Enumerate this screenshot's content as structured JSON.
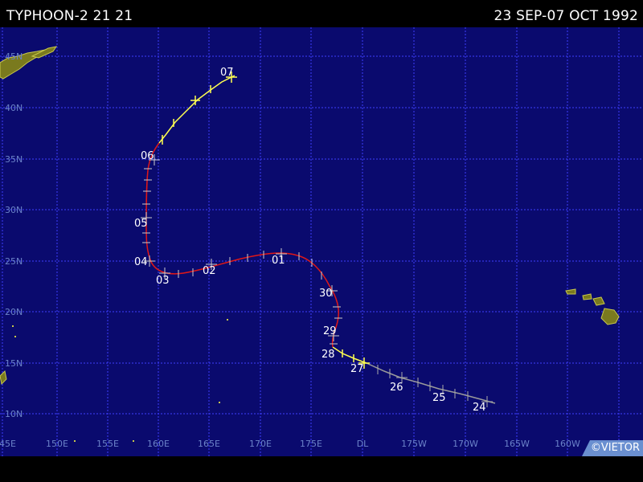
{
  "header": {
    "storm_name": "TYPHOON-2 21 21",
    "date_range": "23 SEP-07 OCT 1992"
  },
  "credit": "©VIETOR",
  "map": {
    "colors": {
      "ocean": "#0a0a6e",
      "grid": "#3d3dff",
      "land": "#7a7a1e",
      "land_edge": "#c8c84a",
      "axis_label": "#6b83c9",
      "track_depression": "#9a9a9a",
      "track_storm": "#ffff50",
      "track_typhoon": "#e01818",
      "day_label": "#ffffff"
    },
    "longitude_labels": [
      "145E",
      "150E",
      "155E",
      "160E",
      "165E",
      "170E",
      "175E",
      "DL",
      "175W",
      "170W",
      "165W",
      "160W"
    ],
    "latitude_labels": [
      "10N",
      "15N",
      "20N",
      "25N",
      "30N",
      "35N",
      "40N",
      "45N"
    ],
    "day_labels": [
      "24",
      "25",
      "26",
      "27",
      "28",
      "29",
      "30",
      "01",
      "02",
      "03",
      "04",
      "05",
      "06",
      "07"
    ]
  }
}
